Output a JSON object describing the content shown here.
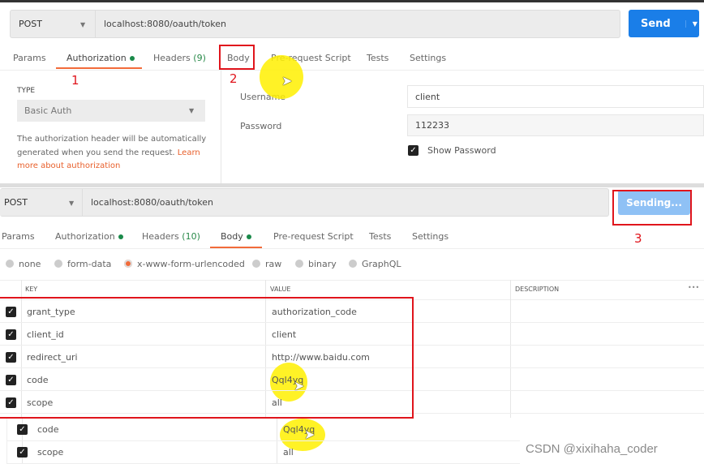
{
  "top_panel": {
    "method": "POST",
    "url": "localhost:8080/oauth/token",
    "send_label": "Send",
    "tabs": [
      {
        "label": "Params"
      },
      {
        "label": "Authorization",
        "dot": true
      },
      {
        "label": "Headers",
        "count": "(9)"
      },
      {
        "label": "Body"
      },
      {
        "label": "Pre-request Script"
      },
      {
        "label": "Tests"
      },
      {
        "label": "Settings"
      }
    ],
    "active_tab": "Authorization",
    "type_label": "TYPE",
    "auth_type": "Basic Auth",
    "description": "The authorization header will be automatically generated when you send the request.",
    "learn_more": "Learn more about authorization",
    "username_label": "Username",
    "username_value": "client",
    "password_label": "Password",
    "password_value": "112233",
    "show_password_label": "Show Password",
    "show_password_checked": true
  },
  "bottom_panel": {
    "method": "POST",
    "url": "localhost:8080/oauth/token",
    "send_label": "Sending...",
    "tabs": [
      {
        "label": "Params"
      },
      {
        "label": "Authorization",
        "dot": true
      },
      {
        "label": "Headers",
        "count": "(10)"
      },
      {
        "label": "Body",
        "dot": true
      },
      {
        "label": "Pre-request Script"
      },
      {
        "label": "Tests"
      },
      {
        "label": "Settings"
      }
    ],
    "active_tab": "Body",
    "body_types": [
      "none",
      "form-data",
      "x-www-form-urlencoded",
      "raw",
      "binary",
      "GraphQL"
    ],
    "selected_body_type": "x-www-form-urlencoded",
    "columns": {
      "key": "KEY",
      "value": "VALUE",
      "description": "DESCRIPTION",
      "more": "•••"
    },
    "rows": [
      {
        "key": "grant_type",
        "value": "authorization_code"
      },
      {
        "key": "client_id",
        "value": "client"
      },
      {
        "key": "redirect_uri",
        "value": "http://www.baidu.com"
      },
      {
        "key": "code",
        "value": "Qql4yq"
      },
      {
        "key": "scope",
        "value": "all"
      }
    ],
    "overlay_rows": [
      {
        "key": "code",
        "value": "Qql4yq"
      },
      {
        "key": "scope",
        "value": "all"
      }
    ]
  },
  "annotations": {
    "step1": "1",
    "step2": "2",
    "step3": "3"
  },
  "watermark": "CSDN @xixihaha_coder",
  "colors": {
    "accent": "#f26b3a",
    "send": "#1a7ee8",
    "sending": "#8fc1f5",
    "annotation": "#e0151c",
    "highlight": "#fff000"
  }
}
